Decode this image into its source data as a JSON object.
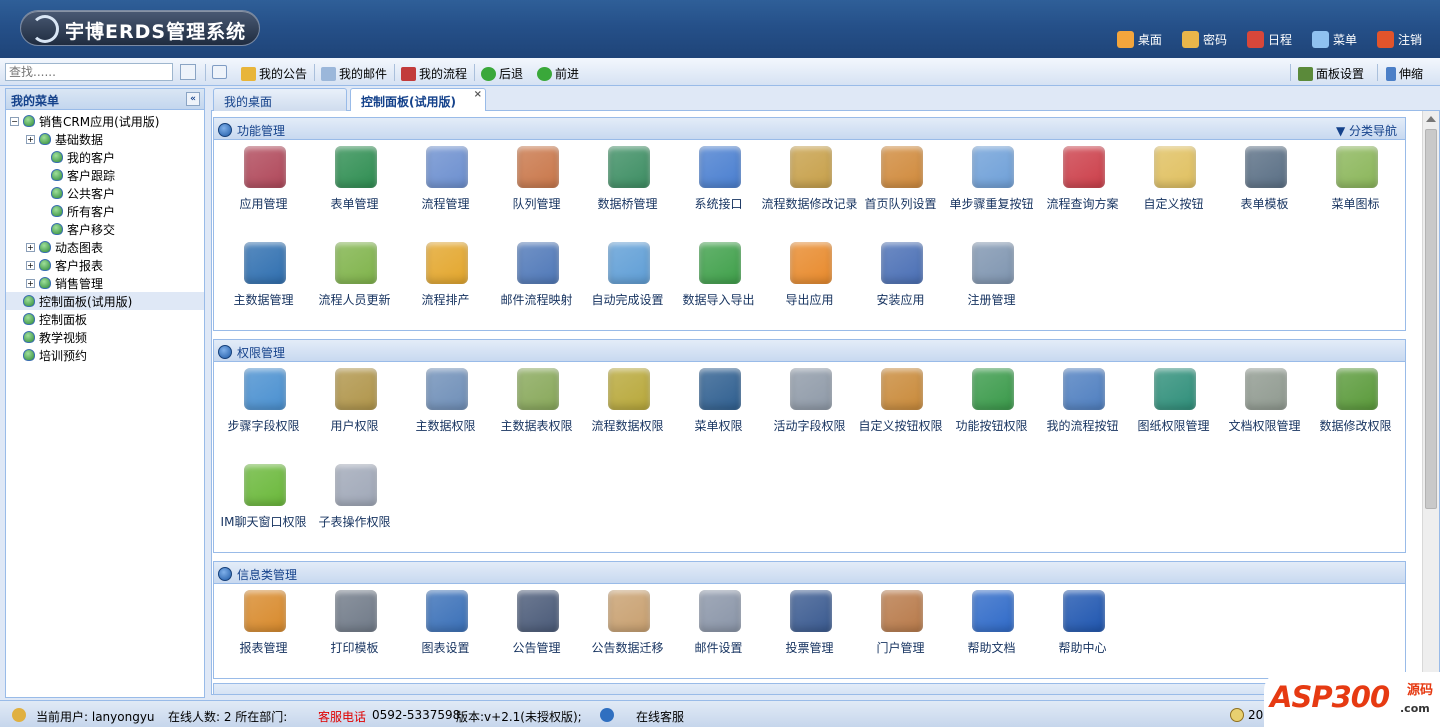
{
  "header": {
    "logo_text": "宇博ERDS管理系统",
    "nav": [
      {
        "label": "桌面",
        "icon": "home-icon",
        "color": "#f3a53c"
      },
      {
        "label": "密码",
        "icon": "lock-icon",
        "color": "#e9b64a"
      },
      {
        "label": "日程",
        "icon": "calendar-icon",
        "color": "#d8473a"
      },
      {
        "label": "菜单",
        "icon": "menu-icon",
        "color": "#8fc1f0"
      },
      {
        "label": "注销",
        "icon": "power-icon",
        "color": "#e2542b"
      }
    ]
  },
  "toolbar": {
    "search_placeholder": "查找......",
    "left_items": [
      {
        "label": "我的公告",
        "icon": "announcement-icon",
        "color": "#e8b53a"
      },
      {
        "label": "我的邮件",
        "icon": "mail-icon",
        "color": "#9bb7da"
      },
      {
        "label": "我的流程",
        "icon": "workflow-icon",
        "color": "#c23b3b"
      },
      {
        "label": "后退",
        "icon": "back-icon",
        "color": "#3aa83a"
      },
      {
        "label": "前进",
        "icon": "forward-icon",
        "color": "#3aa83a"
      }
    ],
    "right_items": [
      {
        "label": "面板设置",
        "icon": "panel-settings-icon",
        "color": "#5b8a3a"
      },
      {
        "label": "伸缩",
        "icon": "expand-icon",
        "color": "#4b7fc7"
      }
    ]
  },
  "sidebar": {
    "title": "我的菜单",
    "tree": [
      {
        "label": "销售CRM应用(试用版)",
        "level": 0,
        "toggle": "−"
      },
      {
        "label": "基础数据",
        "level": 1,
        "toggle": "+"
      },
      {
        "label": "我的客户",
        "level": 2
      },
      {
        "label": "客户跟踪",
        "level": 2
      },
      {
        "label": "公共客户",
        "level": 2
      },
      {
        "label": "所有客户",
        "level": 2
      },
      {
        "label": "客户移交",
        "level": 2
      },
      {
        "label": "动态图表",
        "level": 1,
        "toggle": "+"
      },
      {
        "label": "客户报表",
        "level": 1,
        "toggle": "+"
      },
      {
        "label": "销售管理",
        "level": 1,
        "toggle": "+"
      },
      {
        "label": "控制面板(试用版)",
        "level": 0,
        "selected": true
      },
      {
        "label": "控制面板",
        "level": 0
      },
      {
        "label": "教学视频",
        "level": 0
      },
      {
        "label": "培训预约",
        "level": 0
      }
    ]
  },
  "tabs": [
    {
      "label": "我的桌面"
    },
    {
      "label": "控制面板(试用版)",
      "close": "×"
    }
  ],
  "panels": [
    {
      "title": "功能管理",
      "right": "▼ 分类导航",
      "items": [
        {
          "label": "应用管理",
          "color": "#b0485a"
        },
        {
          "label": "表单管理",
          "color": "#2f8e52"
        },
        {
          "label": "流程管理",
          "color": "#6c8fcf"
        },
        {
          "label": "队列管理",
          "color": "#c9774a"
        },
        {
          "label": "数据桥管理",
          "color": "#3d8e63"
        },
        {
          "label": "系统接口",
          "color": "#4a7fd0"
        },
        {
          "label": "流程数据修改记录",
          "color": "#c7a04a"
        },
        {
          "label": "首页队列设置",
          "color": "#d08a3c"
        },
        {
          "label": "单步骤重复按钮",
          "color": "#6fa0d8"
        },
        {
          "label": "流程查询方案",
          "color": "#cc3f4a"
        },
        {
          "label": "自定义按钮",
          "color": "#e0c060"
        },
        {
          "label": "表单模板",
          "color": "#5a6f85"
        },
        {
          "label": "菜单图标",
          "color": "#8bb65a"
        },
        {
          "label": "主数据管理",
          "color": "#2f6fb0"
        },
        {
          "label": "流程人员更新",
          "color": "#7fb34a"
        },
        {
          "label": "流程排产",
          "color": "#e3a62c"
        },
        {
          "label": "邮件流程映射",
          "color": "#4f78b8"
        },
        {
          "label": "自动完成设置",
          "color": "#5f9ed6"
        },
        {
          "label": "数据导入导出",
          "color": "#3fa04a"
        },
        {
          "label": "导出应用",
          "color": "#e88a2c"
        },
        {
          "label": "安装应用",
          "color": "#4a6fb5"
        },
        {
          "label": "注册管理",
          "color": "#7f95b0"
        }
      ]
    },
    {
      "title": "权限管理",
      "items": [
        {
          "label": "步骤字段权限",
          "color": "#4a90d0"
        },
        {
          "label": "用户权限",
          "color": "#b0954a"
        },
        {
          "label": "主数据权限",
          "color": "#6f8fb8"
        },
        {
          "label": "主数据表权限",
          "color": "#88a85a"
        },
        {
          "label": "流程数据权限",
          "color": "#b8a83a"
        },
        {
          "label": "菜单权限",
          "color": "#2f5f90"
        },
        {
          "label": "活动字段权限",
          "color": "#8f9aa8"
        },
        {
          "label": "自定义按钮权限",
          "color": "#c98a3a"
        },
        {
          "label": "功能按钮权限",
          "color": "#3a9a4a"
        },
        {
          "label": "我的流程按钮",
          "color": "#4f7fc0"
        },
        {
          "label": "图纸权限管理",
          "color": "#2f8f7a"
        },
        {
          "label": "文档权限管理",
          "color": "#909a90"
        },
        {
          "label": "数据修改权限",
          "color": "#5a9a3a"
        },
        {
          "label": "IM聊天窗口权限",
          "color": "#6ab83a"
        },
        {
          "label": "子表操作权限",
          "color": "#a0a8b8"
        }
      ]
    },
    {
      "title": "信息类管理",
      "items": [
        {
          "label": "报表管理",
          "color": "#d88a2c"
        },
        {
          "label": "打印模板",
          "color": "#707a88"
        },
        {
          "label": "图表设置",
          "color": "#3a70b8"
        },
        {
          "label": "公告管理",
          "color": "#4a5a78"
        },
        {
          "label": "公告数据迁移",
          "color": "#c8a070"
        },
        {
          "label": "邮件设置",
          "color": "#8a95a8"
        },
        {
          "label": "投票管理",
          "color": "#3a5a90"
        },
        {
          "label": "门户管理",
          "color": "#b87a4a"
        },
        {
          "label": "帮助文档",
          "color": "#2f6ac8"
        },
        {
          "label": "帮助中心",
          "color": "#1f56b0"
        }
      ]
    }
  ],
  "footer": {
    "user_label": "当前用户: lanyongyu",
    "online_label": "在线人数: 2 所在部门:",
    "hotline_label": "客服电话",
    "phone": "0592-5337598",
    "version": "版本:v+2.1(未授权版);",
    "online_service": "在线客服",
    "date_prefix": "20"
  },
  "watermark": {
    "text": "ASP300",
    "sub": "源码",
    "domain": ".com"
  }
}
